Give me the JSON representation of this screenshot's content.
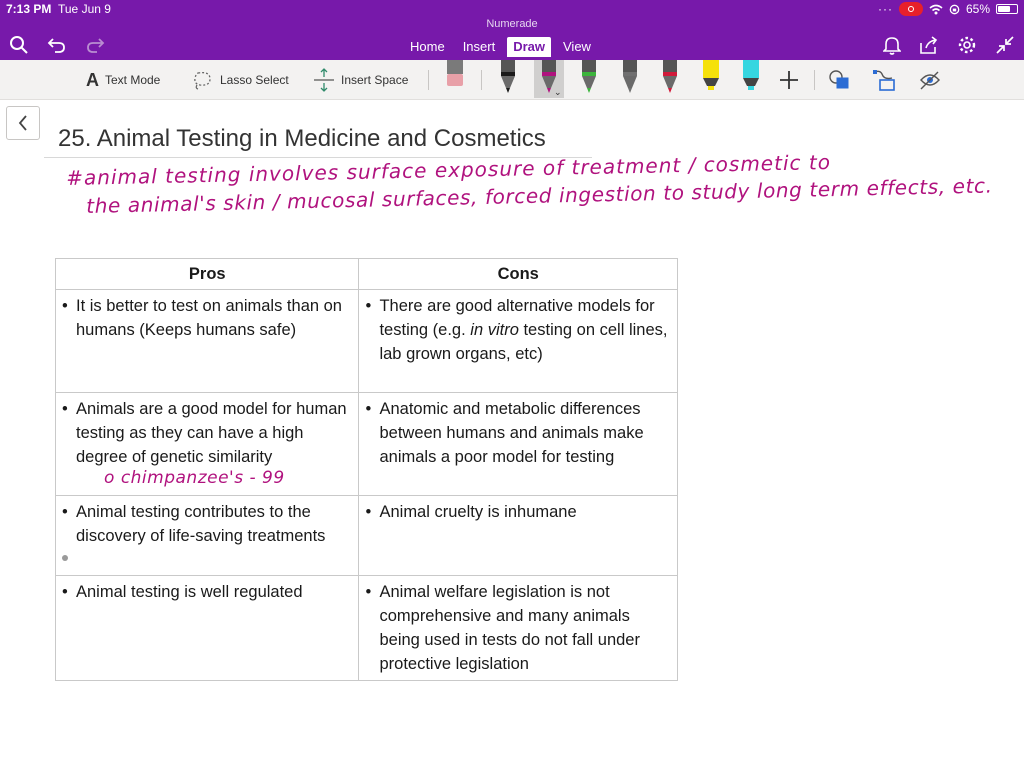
{
  "status_bar": {
    "time": "7:13 PM",
    "date": "Tue Jun 9",
    "battery": "65%",
    "battery_level": 0.65
  },
  "app": {
    "title": "Numerade",
    "tabs": [
      {
        "label": "Home"
      },
      {
        "label": "Insert"
      },
      {
        "label": "Draw",
        "active": true
      },
      {
        "label": "View"
      }
    ],
    "accent": "#7719aa"
  },
  "ribbon": {
    "text_mode": "Text Mode",
    "lasso_select": "Lasso Select",
    "insert_space": "Insert Space",
    "pens": [
      {
        "name": "eraser",
        "color": "#e8a0a8"
      },
      {
        "name": "pen-black",
        "color": "#1a1a1a"
      },
      {
        "name": "pen-magenta",
        "color": "#b0127e",
        "selected": true
      },
      {
        "name": "pen-green",
        "color": "#3cb43c"
      },
      {
        "name": "pen-gray",
        "color": "#707070"
      },
      {
        "name": "pen-red",
        "color": "#d01a3a"
      },
      {
        "name": "highlighter-yellow",
        "color": "#f5e10a"
      },
      {
        "name": "highlighter-cyan",
        "color": "#35d6e0"
      }
    ]
  },
  "page": {
    "title": "25. Animal Testing in Medicine and Cosmetics",
    "ink_line1": "#animal testing involves surface exposure of treatment / cosmetic to",
    "ink_line2": "the animal's skin / mucosal surfaces, forced ingestion to study long term effects, etc.",
    "ink_note": "chimpanzee's - 99"
  },
  "table": {
    "headers": {
      "pros": "Pros",
      "cons": "Cons"
    },
    "rows": [
      {
        "pro": "It is better to test on animals than on humans (Keeps humans safe)",
        "con_pre": "There are good alternative models for testing (e.g. ",
        "con_em": "in vitro",
        "con_post": " testing on cell lines, lab grown organs, etc)"
      },
      {
        "pro": "Animals are a good model for human testing as they can have a high degree of genetic similarity",
        "con": "Anatomic and metabolic differences between humans and animals make animals a poor model for testing"
      },
      {
        "pro": "Animal testing contributes to the discovery of life-saving treatments",
        "con": "Animal cruelty is inhumane"
      },
      {
        "pro": "Animal testing is well regulated",
        "con": "Animal welfare legislation is not comprehensive and many animals being used in tests do not fall under protective legislation"
      }
    ]
  }
}
